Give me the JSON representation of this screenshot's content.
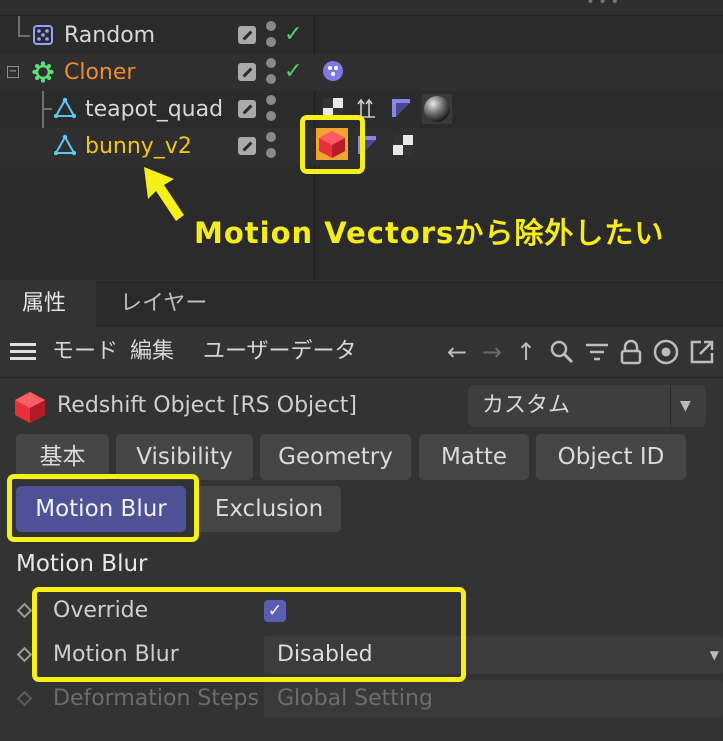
{
  "object_manager": {
    "objects": [
      {
        "name": "Random",
        "icon": "random-effector-icon",
        "color": "#d8d8d8"
      },
      {
        "name": "Cloner",
        "icon": "cloner-icon",
        "color": "#f08c2e"
      },
      {
        "name": "teapot_quad",
        "icon": "polygon-object-icon",
        "color": "#d8d8d8"
      },
      {
        "name": "bunny_v2",
        "icon": "polygon-object-icon",
        "color": "#f5c518"
      }
    ]
  },
  "annotation": {
    "text": "Motion Vectorsから除外したい",
    "color": "#f7ef1c"
  },
  "attributes": {
    "tabs": [
      "属性",
      "レイヤー"
    ],
    "toolbar": {
      "menu_icon": "hamburger-menu-icon",
      "items": [
        "モード",
        "編集",
        "ユーザーデータ"
      ],
      "icons": [
        "back-arrow-icon",
        "forward-arrow-icon",
        "up-arrow-icon",
        "search-icon",
        "filter-icon",
        "lock-icon",
        "target-icon",
        "new-window-icon"
      ]
    },
    "object_title": "Redshift Object [RS Object]",
    "preset": "カスタム",
    "property_tabs_row1": [
      "基本",
      "Visibility",
      "Geometry",
      "Matte",
      "Object ID"
    ],
    "property_tabs_row2": [
      "Motion Blur",
      "Exclusion"
    ],
    "active_tab": "Motion Blur",
    "section_title": "Motion Blur",
    "properties": [
      {
        "label": "Override",
        "type": "checkbox",
        "checked": true
      },
      {
        "label": "Motion Blur",
        "type": "dropdown",
        "value": "Disabled"
      },
      {
        "label": "Deformation Steps",
        "type": "dropdown",
        "value": "Global Setting",
        "disabled": true
      }
    ]
  }
}
